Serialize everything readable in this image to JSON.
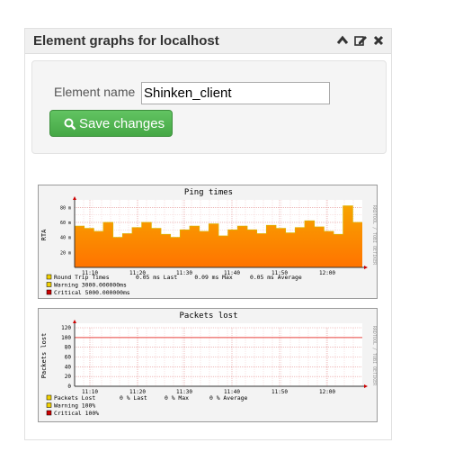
{
  "widget": {
    "title": "Element graphs for localhost",
    "icons": [
      "chevron-up-icon",
      "edit-icon",
      "close-icon"
    ]
  },
  "form": {
    "label": "Element name",
    "value": "Shinken_client",
    "save_label": "Save changes",
    "save_icon": "search-icon",
    "button_color": "#5cb85c"
  },
  "graphs": [
    {
      "title": "Ping times",
      "ylabel": "RTA",
      "side_text": "RRDTOOL / TOBI OETIKER",
      "yticks": [
        "80 m",
        "60 m",
        "40 m",
        "20 m"
      ],
      "xticks": [
        "11:10",
        "11:20",
        "11:30",
        "11:40",
        "11:50",
        "12:00"
      ],
      "legend": [
        {
          "color": "#f0d000",
          "label": "Round Trip Times",
          "stats": "0.05 ms Last     0.09 ms Max     0.05 ms Average"
        },
        {
          "color": "#f0d000",
          "label": "Warning  3000.000000ms",
          "stats": ""
        },
        {
          "color": "#cc0000",
          "label": "Critical 5000.000000ms",
          "stats": ""
        }
      ]
    },
    {
      "title": "Packets lost",
      "ylabel": "Packets lost",
      "side_text": "RRDTOOL / TOBI OETIKER",
      "yticks": [
        "120",
        "100",
        "80",
        "60",
        "40",
        "20",
        "0"
      ],
      "xticks": [
        "11:10",
        "11:20",
        "11:30",
        "11:40",
        "11:50",
        "12:00"
      ],
      "legend": [
        {
          "color": "#f0d000",
          "label": "Packets Lost",
          "stats": "0 % Last     0 % Max      0 % Average"
        },
        {
          "color": "#f0d000",
          "label": "Warning  100%",
          "stats": ""
        },
        {
          "color": "#cc0000",
          "label": "Critical 100%",
          "stats": ""
        }
      ]
    }
  ],
  "chart_data": [
    {
      "type": "area",
      "title": "Ping times",
      "ylabel": "RTA",
      "ylim": [
        0,
        90
      ],
      "x": [
        "11:06",
        "11:08",
        "11:10",
        "11:12",
        "11:14",
        "11:16",
        "11:18",
        "11:20",
        "11:22",
        "11:24",
        "11:26",
        "11:28",
        "11:30",
        "11:32",
        "11:34",
        "11:36",
        "11:38",
        "11:40",
        "11:42",
        "11:44",
        "11:46",
        "11:48",
        "11:50",
        "11:52",
        "11:54",
        "11:56",
        "11:58",
        "12:00",
        "12:02",
        "12:04"
      ],
      "series": [
        {
          "name": "Round Trip Times",
          "values": [
            55,
            52,
            48,
            60,
            40,
            45,
            53,
            60,
            52,
            44,
            40,
            50,
            55,
            48,
            58,
            42,
            50,
            55,
            50,
            45,
            56,
            52,
            46,
            53,
            62,
            54,
            48,
            44,
            82,
            60
          ]
        }
      ]
    },
    {
      "type": "line",
      "title": "Packets lost",
      "ylabel": "Packets lost",
      "ylim": [
        0,
        120
      ],
      "x": [
        "11:06",
        "12:04"
      ],
      "series": [
        {
          "name": "Packets Lost",
          "values": [
            0,
            0
          ]
        },
        {
          "values": [
            100,
            100
          ]
        }
      ]
    }
  ]
}
